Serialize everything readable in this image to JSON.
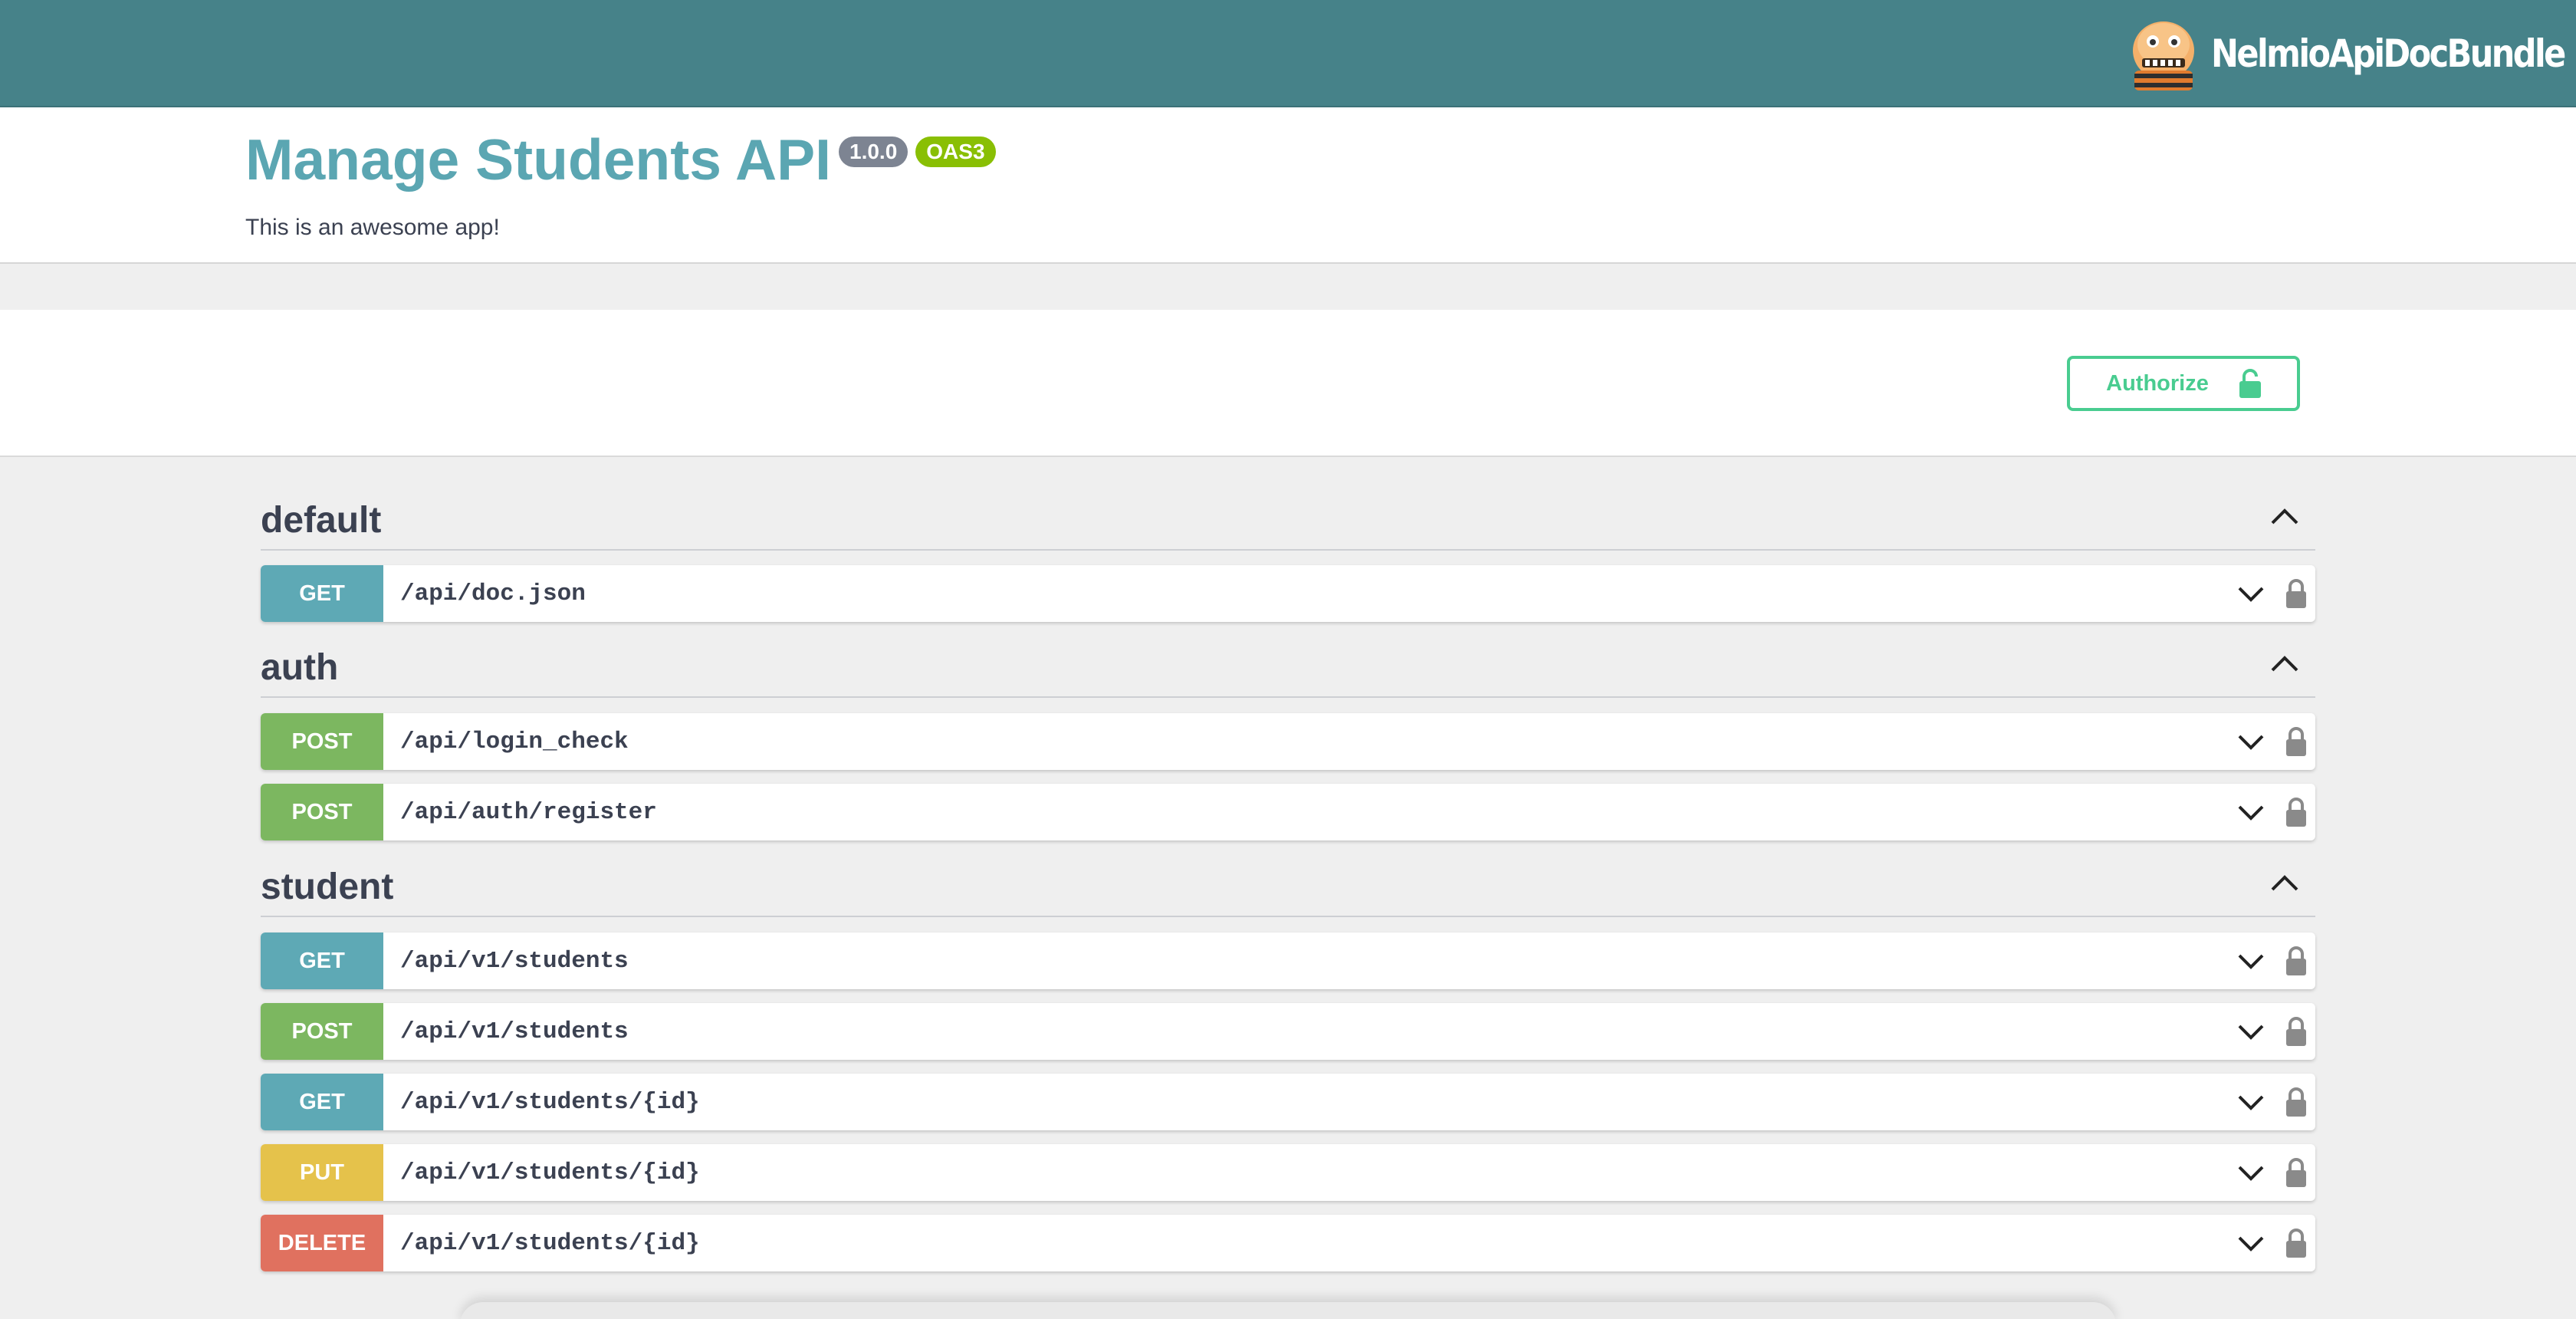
{
  "brand": {
    "name": "NelmioApiDocBundle"
  },
  "info": {
    "title": "Manage Students API",
    "version": "1.0.0",
    "spec_badge": "OAS3",
    "description": "This is an awesome app!"
  },
  "auth": {
    "authorize_label": "Authorize"
  },
  "colors": {
    "topbar": "#468289",
    "title": "#5ba6b2",
    "get": "#5ea9b5",
    "post": "#7cb760",
    "put": "#e5c24b",
    "delete": "#e0715f",
    "authorize": "#49cc90"
  },
  "sections": [
    {
      "name": "default",
      "operations": [
        {
          "method": "GET",
          "path": "/api/doc.json"
        }
      ]
    },
    {
      "name": "auth",
      "operations": [
        {
          "method": "POST",
          "path": "/api/login_check"
        },
        {
          "method": "POST",
          "path": "/api/auth/register"
        }
      ]
    },
    {
      "name": "student",
      "operations": [
        {
          "method": "GET",
          "path": "/api/v1/students"
        },
        {
          "method": "POST",
          "path": "/api/v1/students"
        },
        {
          "method": "GET",
          "path": "/api/v1/students/{id}"
        },
        {
          "method": "PUT",
          "path": "/api/v1/students/{id}"
        },
        {
          "method": "DELETE",
          "path": "/api/v1/students/{id}"
        }
      ]
    }
  ]
}
